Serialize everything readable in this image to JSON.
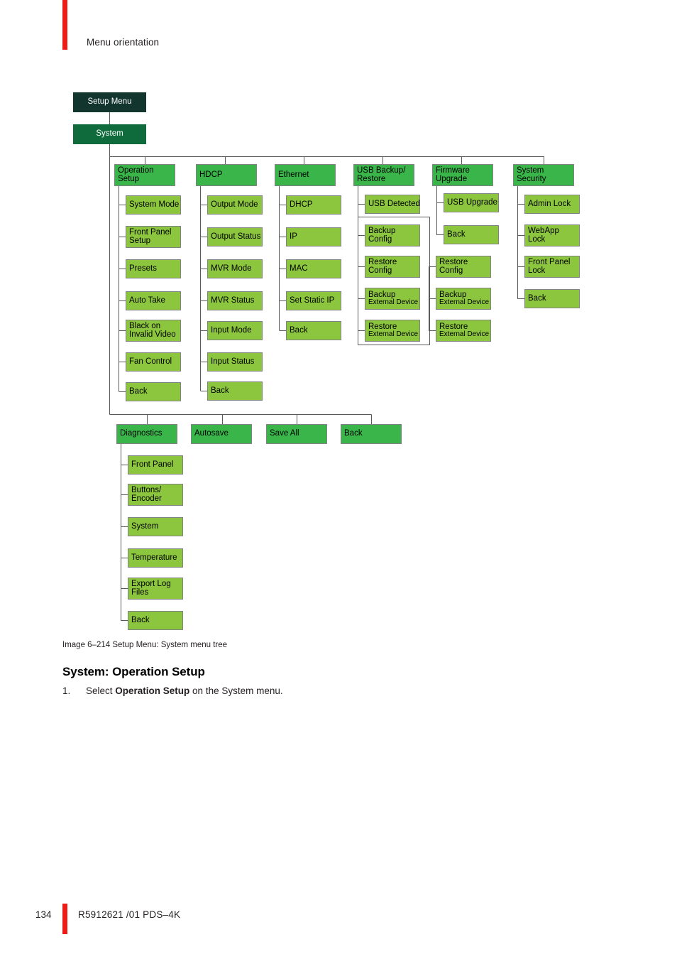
{
  "page": {
    "running_header": "Menu orientation",
    "page_number": "134",
    "doc_id": "R5912621 /01  PDS–4K",
    "figure_caption": "Image 6–214  Setup Menu: System menu tree",
    "section_heading": "System: Operation Setup",
    "step_1_number": "1.",
    "step_1_before": "Select ",
    "step_1_bold": "Operation Setup",
    "step_1_after": " on the System menu."
  },
  "colors": {
    "root": "#12352e",
    "level1": "#0f6b3c",
    "level2": "#39b54a",
    "level3": "#8cc63e",
    "border": "#808285",
    "accent_red": "#ed1c16"
  },
  "tree": {
    "root": {
      "label": "Setup Menu"
    },
    "level1": {
      "label": "System"
    },
    "columns": [
      {
        "id": "operation-setup",
        "label_line1": "Operation",
        "label_line2": "Setup",
        "children": [
          {
            "line1": "System Mode",
            "line2": ""
          },
          {
            "line1": "Front Panel",
            "line2": "Setup"
          },
          {
            "line1": "Presets",
            "line2": ""
          },
          {
            "line1": "Auto Take",
            "line2": ""
          },
          {
            "line1": "Black on",
            "line2": "Invalid Video"
          },
          {
            "line1": "Fan Control",
            "line2": ""
          },
          {
            "line1": "Back",
            "line2": ""
          }
        ]
      },
      {
        "id": "hdcp",
        "label_line1": "HDCP",
        "label_line2": "",
        "children": [
          {
            "line1": "Output Mode",
            "line2": ""
          },
          {
            "line1": "Output Status",
            "line2": ""
          },
          {
            "line1": "MVR Mode",
            "line2": ""
          },
          {
            "line1": "MVR Status",
            "line2": ""
          },
          {
            "line1": "Input Mode",
            "line2": ""
          },
          {
            "line1": "Input Status",
            "line2": ""
          },
          {
            "line1": "Back",
            "line2": ""
          }
        ]
      },
      {
        "id": "ethernet",
        "label_line1": "Ethernet",
        "label_line2": "",
        "children": [
          {
            "line1": "DHCP",
            "line2": ""
          },
          {
            "line1": "IP",
            "line2": ""
          },
          {
            "line1": "MAC",
            "line2": ""
          },
          {
            "line1": "Set Static IP",
            "line2": ""
          },
          {
            "line1": "Back",
            "line2": ""
          }
        ]
      },
      {
        "id": "usb-backup-restore",
        "label_line1": "USB Backup/",
        "label_line2": "Restore",
        "children": [
          {
            "line1": "USB Detected",
            "line2": ""
          },
          {
            "line1": "Backup",
            "line2": "Config"
          },
          {
            "line1": "Restore",
            "line2": "Config"
          },
          {
            "line1": "Backup",
            "line2": "External Device"
          },
          {
            "line1": "Restore",
            "line2": "External Device"
          }
        ]
      },
      {
        "id": "firmware-upgrade",
        "label_line1": "Firmware",
        "label_line2": "Upgrade",
        "children": [
          {
            "line1": "USB Upgrade",
            "line2": ""
          },
          {
            "line1": "Back",
            "line2": ""
          }
        ],
        "extra_children": [
          {
            "line1": "Restore",
            "line2": "Config"
          },
          {
            "line1": "Backup",
            "line2": "External Device"
          },
          {
            "line1": "Restore",
            "line2": "External Device"
          }
        ]
      },
      {
        "id": "system-security",
        "label_line1": "System",
        "label_line2": "Security",
        "children": [
          {
            "line1": "Admin Lock",
            "line2": ""
          },
          {
            "line1": "WebApp",
            "line2": "Lock"
          },
          {
            "line1": "Front Panel",
            "line2": "Lock"
          },
          {
            "line1": "Back",
            "line2": ""
          }
        ]
      }
    ],
    "bottom_row": [
      {
        "id": "diagnostics",
        "label_line1": "Diagnostics",
        "label_line2": "",
        "children": [
          {
            "line1": "Front Panel",
            "line2": ""
          },
          {
            "line1": "Buttons/",
            "line2": "Encoder"
          },
          {
            "line1": "System",
            "line2": ""
          },
          {
            "line1": "Temperature",
            "line2": ""
          },
          {
            "line1": "Export Log",
            "line2": "Files"
          },
          {
            "line1": "Back",
            "line2": ""
          }
        ]
      },
      {
        "id": "autosave",
        "label_line1": "Autosave",
        "label_line2": "",
        "children": []
      },
      {
        "id": "save-all",
        "label_line1": "Save All",
        "label_line2": "",
        "children": []
      },
      {
        "id": "back",
        "label_line1": "Back",
        "label_line2": "",
        "children": []
      }
    ]
  }
}
